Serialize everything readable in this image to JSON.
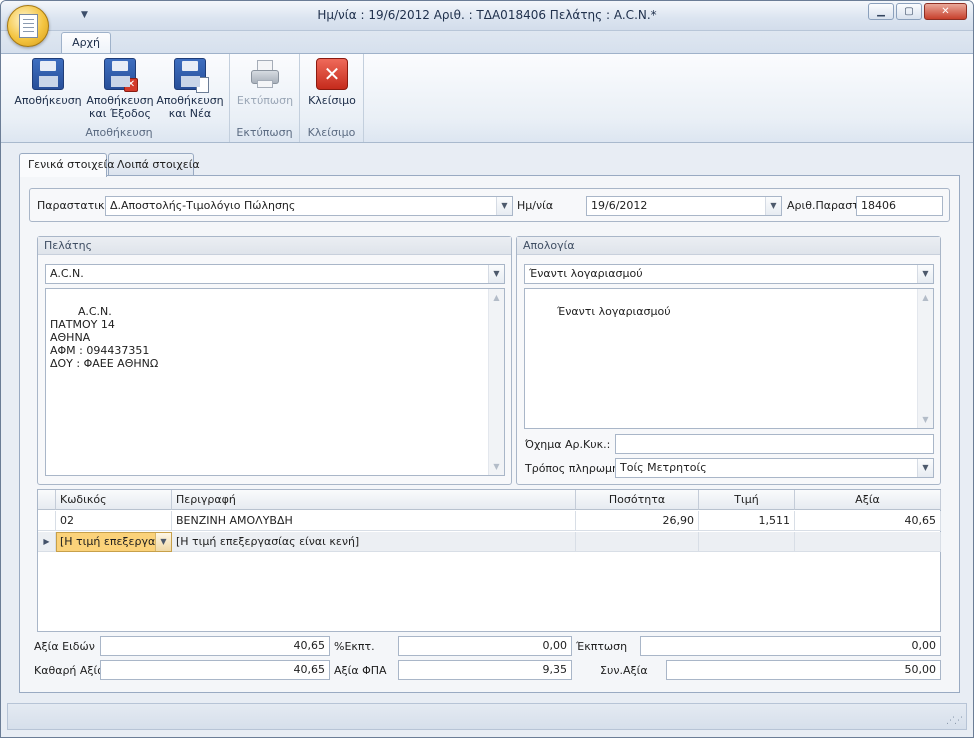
{
  "window": {
    "title": "Ημ/νία : 19/6/2012  Αριθ. : ΤΔΑ018406 Πελάτης : A.C.N.*",
    "min_icon": "minimize-icon",
    "max_icon": "maximize-icon",
    "close_icon": "close-icon"
  },
  "ribbon": {
    "tab": "Αρχή",
    "groups": {
      "save": {
        "label": "Αποθήκευση",
        "save": "Αποθήκευση",
        "save_exit_1": "Αποθήκευση",
        "save_exit_2": "και Έξοδος",
        "save_new_1": "Αποθήκευση",
        "save_new_2": "και Νέα"
      },
      "print": {
        "label": "Εκτύπωση",
        "print": "Εκτύπωση"
      },
      "close": {
        "label": "Κλείσιμο",
        "close": "Κλείσιμο"
      }
    }
  },
  "tabs": {
    "general": "Γενικά στοιχεία",
    "other": "Λοιπά στοιχεία"
  },
  "header": {
    "doc_label": "Παραστατικό",
    "doc_value": "Δ.Αποστολής-Τιμολόγιο Πώλησης",
    "date_label": "Ημ/νία",
    "date_value": "19/6/2012",
    "num_label": "Αριθ.Παραστ.",
    "num_value": "18406"
  },
  "customer": {
    "title": "Πελάτης",
    "value": "A.C.N.",
    "details": "A.C.N.\nΠΑΤΜΟΥ 14\nΑΘΗΝΑ\nΑΦΜ : 094437351\nΔΟΥ : ΦΑΕΕ ΑΘΗΝΩ"
  },
  "reason": {
    "title": "Απολογία",
    "value": "Έναντι λογαριασμού",
    "memo": "Έναντι λογαριασμού",
    "vehicle_label": "Όχημα Αρ.Κυκ.:",
    "vehicle_value": "",
    "payment_label": "Τρόπος πληρωμής",
    "payment_value": "Τοίς Μετρητοίς"
  },
  "grid": {
    "columns": [
      "Κωδικός",
      "Περιγραφή",
      "Ποσότητα",
      "Τιμή",
      "Αξία"
    ],
    "rows": [
      {
        "code": "02",
        "desc": "ΒΕΝΖΙΝΗ ΑΜΟΛΥΒΔΗ",
        "qty": "26,90",
        "price": "1,511",
        "value": "40,65"
      }
    ],
    "new_row_code": "[Η τιμή επεξεργα...",
    "new_row_desc": "[Η τιμή επεξεργασίας είναι κενή]"
  },
  "totals": {
    "items_label": "Αξία Ειδών",
    "items_value": "40,65",
    "disc_pct_label": "%Εκπτ.",
    "disc_pct_value": "0,00",
    "disc_label": "Έκπτωση",
    "disc_value": "0,00",
    "net_label": "Καθαρή Αξία",
    "net_value": "40,65",
    "vat_label": "Αξία ΦΠΑ",
    "vat_value": "9,35",
    "total_label": "Συν.Αξία",
    "total_value": "50,00"
  }
}
